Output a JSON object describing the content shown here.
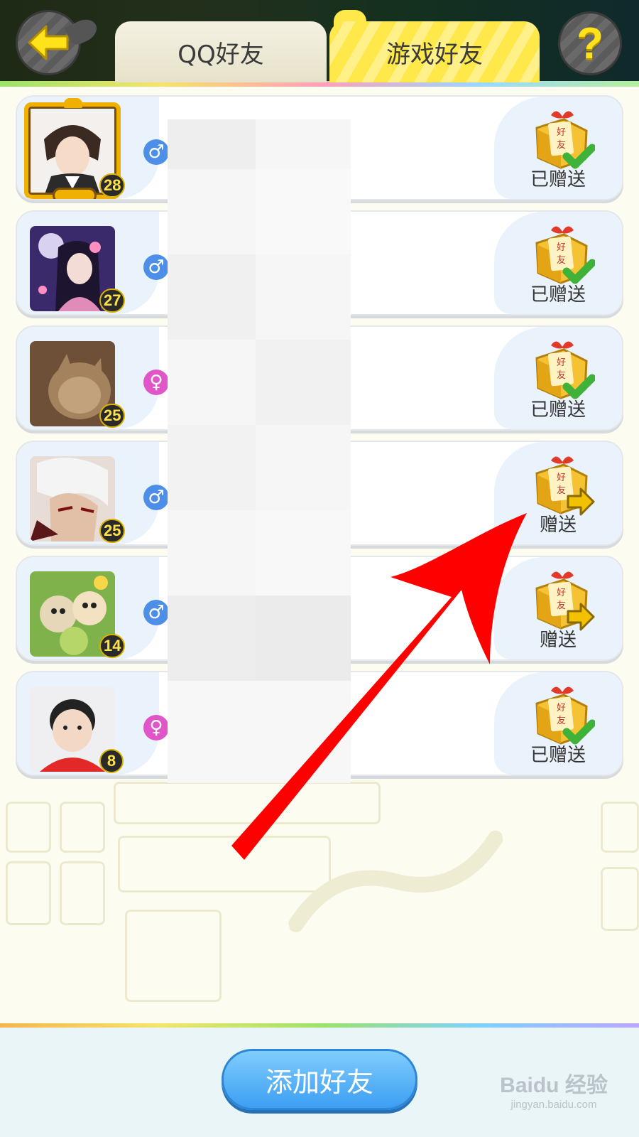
{
  "header": {
    "tabs": [
      {
        "label": "QQ好友",
        "active": false
      },
      {
        "label": "游戏好友",
        "active": true
      }
    ],
    "help_label": "?"
  },
  "friends": [
    {
      "level": "28",
      "gender": "male",
      "gender_symbol": "♂",
      "gift_status": "已赠送",
      "gift_sent": true,
      "avatar": "anime-boy-avatar",
      "framed": true
    },
    {
      "level": "27",
      "gender": "male",
      "gender_symbol": "♂",
      "gift_status": "已赠送",
      "gift_sent": true,
      "avatar": "anime-girl-moon-avatar",
      "framed": false
    },
    {
      "level": "25",
      "gender": "female",
      "gender_symbol": "♀",
      "gift_status": "已赠送",
      "gift_sent": true,
      "avatar": "cat-avatar",
      "framed": false
    },
    {
      "level": "25",
      "gender": "male",
      "gender_symbol": "♂",
      "gift_status": "赠送",
      "gift_sent": false,
      "avatar": "white-hair-warrior-avatar",
      "framed": false
    },
    {
      "level": "14",
      "gender": "male",
      "gender_symbol": "♂",
      "gift_status": "赠送",
      "gift_sent": false,
      "avatar": "cartoon-pets-avatar",
      "framed": false
    },
    {
      "level": "8",
      "gender": "female",
      "gender_symbol": "♀",
      "gift_status": "已赠送",
      "gift_sent": true,
      "avatar": "baby-photo-avatar",
      "framed": false
    }
  ],
  "gift_box_text": [
    "好",
    "友"
  ],
  "bottom": {
    "add_friend_label": "添加好友"
  },
  "watermark": {
    "logo": "Baidu 经验",
    "url": "jingyan.baidu.com"
  },
  "colors": {
    "male": "#4c8ee8",
    "female": "#e056c8",
    "sent_check": "#3fb23a",
    "send_arrow": "#f2c200",
    "annotation_arrow": "#ff0000"
  }
}
